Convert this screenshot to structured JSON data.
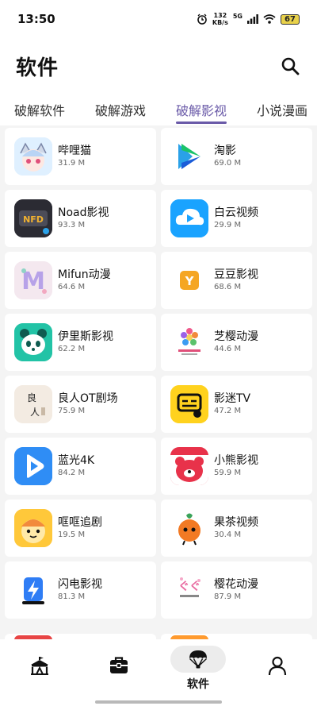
{
  "status_bar": {
    "time": "13:50",
    "net_speed_value": "132",
    "net_speed_unit": "KB/s",
    "network_type": "5G",
    "battery": "67"
  },
  "header": {
    "title": "软件"
  },
  "tabs": [
    {
      "label": "破解软件"
    },
    {
      "label": "破解游戏"
    },
    {
      "label": "破解影视"
    },
    {
      "label": "小说漫画"
    }
  ],
  "active_tab": "破解影视",
  "apps": [
    {
      "name": "哔哩猫",
      "size": "31.9 M",
      "icon": "bilimao-icon",
      "color": "#cfe6ff"
    },
    {
      "name": "淘影",
      "size": "69.0 M",
      "icon": "taoying-icon",
      "color": "#ffffff"
    },
    {
      "name": "Noad影视",
      "size": "93.3 M",
      "icon": "noad-icon",
      "color": "#3a3a44"
    },
    {
      "name": "白云视频",
      "size": "29.9 M",
      "icon": "baiyun-icon",
      "color": "#1aa3ff"
    },
    {
      "name": "Mifun动漫",
      "size": "64.6 M",
      "icon": "mifun-icon",
      "color": "#f2e6ee"
    },
    {
      "name": "豆豆影视",
      "size": "68.6 M",
      "icon": "doudou-icon",
      "color": "#ffffff"
    },
    {
      "name": "伊里斯影视",
      "size": "62.2 M",
      "icon": "panda-icon",
      "color": "#22c3a6"
    },
    {
      "name": "芝樱动漫",
      "size": "44.6 M",
      "icon": "zhiying-icon",
      "color": "#ffffff"
    },
    {
      "name": "良人OT剧场",
      "size": "75.9 M",
      "icon": "liangren-icon",
      "color": "#f3ebe2"
    },
    {
      "name": "影迷TV",
      "size": "47.2 M",
      "icon": "yingmi-icon",
      "color": "#ffd21e"
    },
    {
      "name": "蓝光4K",
      "size": "84.2 M",
      "icon": "languang-icon",
      "color": "#2f8df5"
    },
    {
      "name": "小熊影视",
      "size": "59.9 M",
      "icon": "bear-icon",
      "color": "#e8324a"
    },
    {
      "name": "哐哐追剧",
      "size": "19.5 M",
      "icon": "kuangkuang-icon",
      "color": "#ffc83a"
    },
    {
      "name": "果茶视频",
      "size": "30.4 M",
      "icon": "guocha-icon",
      "color": "#ffffff"
    },
    {
      "name": "闪电影视",
      "size": "81.3 M",
      "icon": "lightning-icon",
      "color": "#ffffff"
    },
    {
      "name": "樱花动漫",
      "size": "87.9 M",
      "icon": "sakura-icon",
      "color": "#ffffff"
    }
  ],
  "bottom_nav": [
    {
      "icon": "circus-tent-icon",
      "label": ""
    },
    {
      "icon": "toolbox-icon",
      "label": ""
    },
    {
      "icon": "parachute-icon",
      "label": "软件"
    },
    {
      "icon": "person-icon",
      "label": ""
    }
  ]
}
